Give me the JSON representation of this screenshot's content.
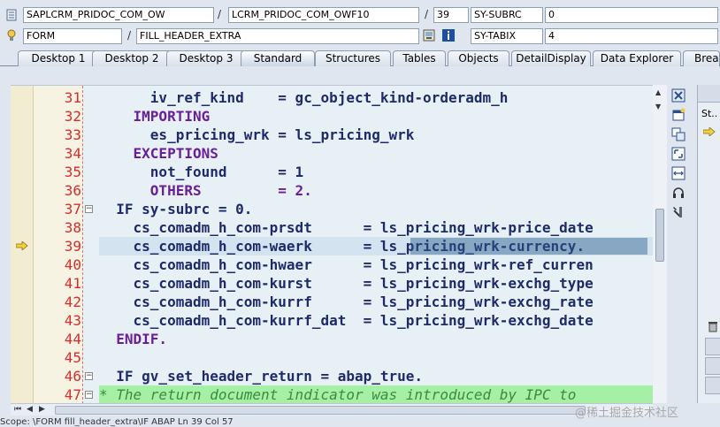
{
  "fields": {
    "program": "SAPLCRM_PRIDOC_COM_OW",
    "include": "LCRM_PRIDOC_COM_OWF10",
    "line": "39",
    "sysvar1_name": "SY-SUBRC",
    "sysvar1_value": "0",
    "event_type": "FORM",
    "event_name": "FILL_HEADER_EXTRA",
    "sysvar2_name": "SY-TABIX",
    "sysvar2_value": "4"
  },
  "tabs": [
    {
      "label": "Desktop 1"
    },
    {
      "label": "Desktop 2"
    },
    {
      "label": "Desktop 3"
    },
    {
      "label": "Standard",
      "active": true
    },
    {
      "label": "Structures"
    },
    {
      "label": "Tables"
    },
    {
      "label": "Objects"
    },
    {
      "label": "DetailDisplay"
    },
    {
      "label": "Data Explorer"
    },
    {
      "label": "Break"
    }
  ],
  "code_lines": [
    {
      "no": "31",
      "text": "      iv_ref_kind    = gc_object_kind-orderadm_h"
    },
    {
      "no": "32",
      "text": "    IMPORTING"
    },
    {
      "no": "33",
      "text": "      es_pricing_wrk = ls_pricing_wrk"
    },
    {
      "no": "34",
      "text": "    EXCEPTIONS"
    },
    {
      "no": "35",
      "text": "      not_found      = 1"
    },
    {
      "no": "36",
      "text": "      OTHERS         = 2."
    },
    {
      "no": "37",
      "text": "  IF sy-subrc = 0."
    },
    {
      "no": "38",
      "text": "    cs_comadm_h_com-prsdt      = ls_pricing_wrk-price_date"
    },
    {
      "no": "39",
      "text": "    cs_comadm_h_com-waerk      = ls_pricing_wrk-currency."
    },
    {
      "no": "40",
      "text": "    cs_comadm_h_com-hwaer      = ls_pricing_wrk-ref_curren"
    },
    {
      "no": "41",
      "text": "    cs_comadm_h_com-kurst      = ls_pricing_wrk-exchg_type"
    },
    {
      "no": "42",
      "text": "    cs_comadm_h_com-kurrf      = ls_pricing_wrk-exchg_rate"
    },
    {
      "no": "43",
      "text": "    cs_comadm_h_com-kurrf_dat  = ls_pricing_wrk-exchg_date"
    },
    {
      "no": "44",
      "text": "  ENDIF."
    },
    {
      "no": "45",
      "text": ""
    },
    {
      "no": "46",
      "text": "  IF gv_set_header_return = abap_true."
    },
    {
      "no": "47",
      "text": "* The return document indicator was introduced by IPC to"
    }
  ],
  "right_panel": {
    "label": "St.."
  },
  "status_bar": {
    "text": "Scope: \\FORM fill_header_extra\\IF                                                                        ABAP    Ln 39 Col 57"
  },
  "watermark": "@稀土掘金技术社区",
  "colors": {
    "line_number": "#d62d2d",
    "keyword": "#6a1f9a",
    "number": "#4aa3e0",
    "comment_bg": "#a6f0a6",
    "selection": "#2c5d8e"
  }
}
